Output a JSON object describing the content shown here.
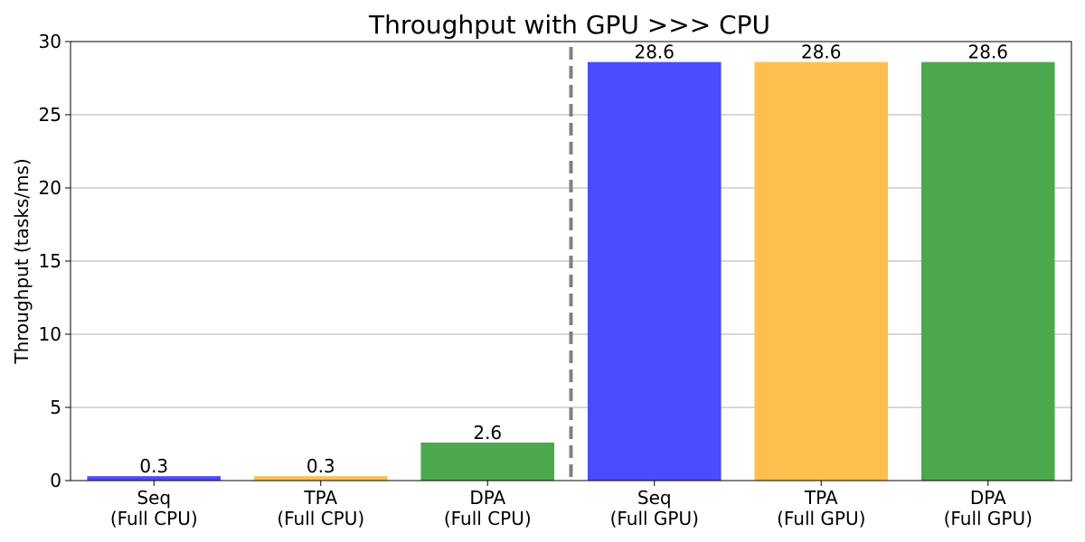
{
  "chart_data": {
    "type": "bar",
    "title": "Throughput with GPU >>> CPU",
    "xlabel": "",
    "ylabel": "Throughput (tasks/ms)",
    "ylim": [
      0,
      30
    ],
    "yticks": [
      0,
      5,
      10,
      15,
      20,
      25,
      30
    ],
    "grid": "y",
    "categories": [
      [
        "Seq",
        "(Full CPU)"
      ],
      [
        "TPA",
        "(Full CPU)"
      ],
      [
        "DPA",
        "(Full CPU)"
      ],
      [
        "Seq",
        "(Full GPU)"
      ],
      [
        "TPA",
        "(Full GPU)"
      ],
      [
        "DPA",
        "(Full GPU)"
      ]
    ],
    "values": [
      0.3,
      0.3,
      2.6,
      28.6,
      28.6,
      28.6
    ],
    "value_labels": [
      "0.3",
      "0.3",
      "2.6",
      "28.6",
      "28.6",
      "28.6"
    ],
    "colors": [
      "#4b4bff",
      "#ffbf4e",
      "#4ca84c",
      "#4b4bff",
      "#ffbf4e",
      "#4ca84c"
    ],
    "separator": {
      "after_index": 2,
      "style": "dashed",
      "color": "#808080"
    }
  }
}
